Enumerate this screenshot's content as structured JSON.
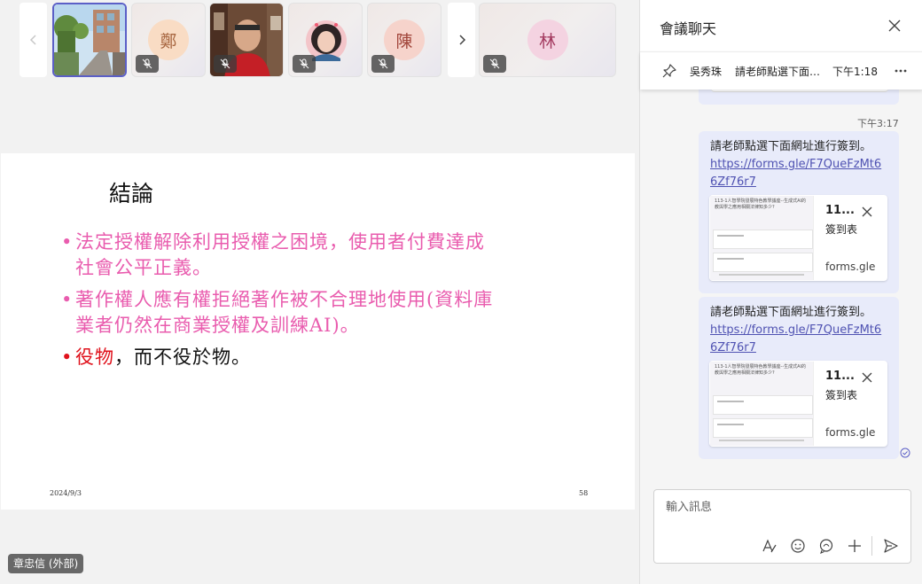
{
  "stage": {
    "participants": [
      {
        "kind": "video",
        "name": "street-video"
      },
      {
        "kind": "initial",
        "initial": "鄭",
        "circle_color": "#f9dcc4",
        "text_color": "#a76640"
      },
      {
        "kind": "video",
        "name": "man-video"
      },
      {
        "kind": "video",
        "name": "woman-video"
      },
      {
        "kind": "initial",
        "initial": "陳",
        "circle_color": "#f6d3cb",
        "text_color": "#a1453a"
      },
      {
        "kind": "initial",
        "initial": "林",
        "circle_color": "#f4d3e1",
        "text_color": "#a2395e"
      }
    ],
    "presenter_name": "章忠信 (外部)"
  },
  "slide": {
    "title": "結論",
    "bullet1_line1": "法定授權解除利用授權之困境，使用者付費達成",
    "bullet1_line2": "社會公平正義。",
    "bullet2_line1": "著作權人應有權拒絕著作被不合理地使用(資料庫",
    "bullet2_line2": "業者仍然在商業授權及訓練AI)。",
    "bullet3_red": "役物",
    "bullet3_rest": "，而不役於物。",
    "bullet_char": "•",
    "date": "2024/9/3",
    "page": "58"
  },
  "chat": {
    "title": "會議聊天",
    "pinned": {
      "sender": "吳秀珠",
      "text": "請老師點選下面連…",
      "time": "下午1:18"
    },
    "message_time": "下午3:17",
    "messages": [
      {
        "text": "請老師點選下面網址進行簽到。",
        "link": "https://forms.gle/F7QueFzMt66Zf76r7",
        "card_title": "11...",
        "card_sub": "簽到表",
        "card_domain": "forms.gle",
        "thumb_heading": "113-1人智學院發展特色教學議座--生成式AI的教與學之應用相關法律知多少?"
      },
      {
        "text": "請老師點選下面網址進行簽到。",
        "link": "https://forms.gle/F7QueFzMt66Zf76r7",
        "card_title": "11...",
        "card_sub": "簽到表",
        "card_domain": "forms.gle",
        "thumb_heading": "113-1人智學院發展特色教學議座--生成式AI的教與學之應用相關法律知多少?"
      }
    ],
    "composer_placeholder": "輸入訊息"
  },
  "colors": {
    "accent": "#5b5fc7",
    "bubble": "#e8ebfa",
    "slide_pink": "#e95cae",
    "slide_red": "#e0121c"
  }
}
